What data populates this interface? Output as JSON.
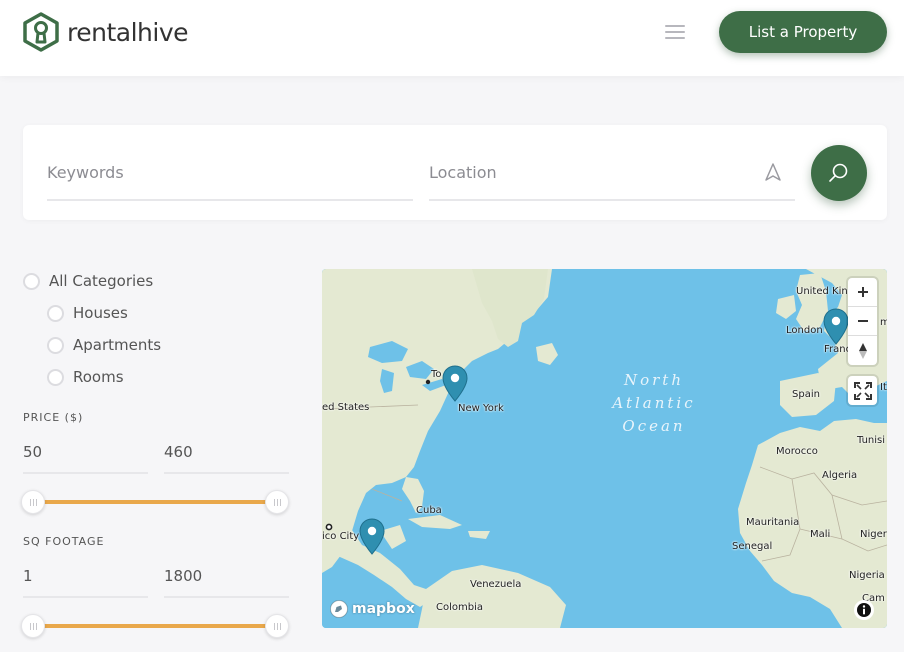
{
  "brand": {
    "name": "rentalhive",
    "accent": "#3e6e47"
  },
  "header": {
    "cta_label": "List a Property",
    "menu_icon": "hamburger-icon"
  },
  "search": {
    "keywords_placeholder": "Keywords",
    "location_placeholder": "Location",
    "locate_icon": "navigation-arrow-icon",
    "submit_icon": "search-icon"
  },
  "filters": {
    "categories": [
      {
        "label": "All Categories",
        "level": 0
      },
      {
        "label": "Houses",
        "level": 1
      },
      {
        "label": "Apartments",
        "level": 1
      },
      {
        "label": "Rooms",
        "level": 1
      }
    ],
    "price": {
      "label": "PRICE ($)",
      "min": "50",
      "max": "460",
      "slider_low": 0,
      "slider_high": 1
    },
    "sqft": {
      "label": "SQ FOOTAGE",
      "min": "1",
      "max": "1800",
      "slider_low": 0,
      "slider_high": 1
    },
    "slider_color": "#e9a84b"
  },
  "map": {
    "ocean_label": [
      "North",
      "Atlantic",
      "Ocean"
    ],
    "places": [
      "United Kingdom",
      "London",
      "Franc",
      "Spain",
      "Tunisi",
      "Morocco",
      "Algeria",
      "Mauritania",
      "Mali",
      "Niger",
      "Senegal",
      "Nigeria",
      "It",
      "ma",
      "Cam",
      "ed States",
      "New York",
      "To",
      "Cuba",
      "ico City",
      "Venezuela",
      "Colombia"
    ],
    "attribution": "mapbox",
    "controls": [
      "zoom-in",
      "zoom-out",
      "reset-north",
      "fullscreen"
    ],
    "water_color": "#6ec1e8",
    "land_color": "#e4e9d2",
    "marker_color": "#2f8fb0"
  }
}
